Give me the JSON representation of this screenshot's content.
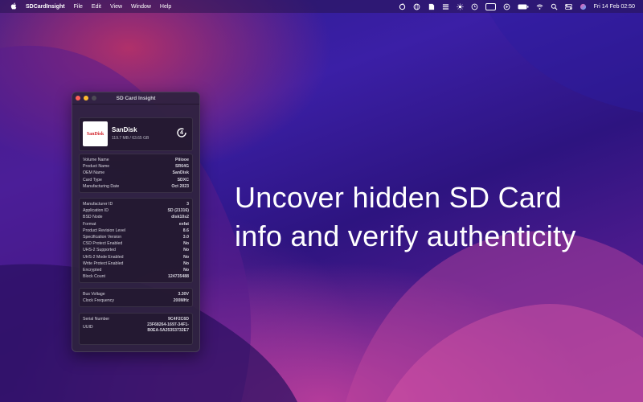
{
  "menubar": {
    "app_name": "SDCardInsight",
    "menus": [
      "File",
      "Edit",
      "View",
      "Window",
      "Help"
    ],
    "clock": "Fri 14 Feb  02:50"
  },
  "window": {
    "title": "SD Card Insight",
    "card": {
      "logo_text": "SanDisk",
      "brand": "SanDisk",
      "capacity": "119.7 MB / 63.65 GB",
      "speed_class": "4"
    },
    "section1": [
      {
        "label": "Volume Name",
        "value": "Piiiooe"
      },
      {
        "label": "Product Name",
        "value": "SR64G"
      },
      {
        "label": "OEM Name",
        "value": "SanDisk"
      },
      {
        "label": "Card Type",
        "value": "SDXC"
      },
      {
        "label": "Manufacturing Date",
        "value": "Oct 2023"
      }
    ],
    "section2": [
      {
        "label": "Manufacturer ID",
        "value": "3"
      },
      {
        "label": "Application ID",
        "value": "SD (21316)"
      },
      {
        "label": "BSD Node",
        "value": "disk10s2"
      },
      {
        "label": "Format",
        "value": "exfat"
      },
      {
        "label": "Product Revision Level",
        "value": "8.6"
      },
      {
        "label": "Specification Version",
        "value": "3.0"
      },
      {
        "label": "CSD Protect Enabled",
        "value": "No"
      },
      {
        "label": "UHS-2 Supported",
        "value": "No"
      },
      {
        "label": "UHS-2 Mode Enabled",
        "value": "No"
      },
      {
        "label": "Write Protect Enabled",
        "value": "No"
      },
      {
        "label": "Encrypted",
        "value": "No"
      },
      {
        "label": "Block Count",
        "value": "124735488"
      }
    ],
    "section3": [
      {
        "label": "Bus Voltage",
        "value": "3.30V"
      },
      {
        "label": "Clock Frequency",
        "value": "200MHz"
      }
    ],
    "section4": {
      "serial_label": "Serial Number",
      "serial_value": "9C4F2C6D",
      "uuid_label": "UUID",
      "uuid_value": "23F68264-1697-34F1-\nB0EA-5A25353732E7"
    }
  },
  "tagline": "Uncover hidden SD Card info and verify authenticity"
}
